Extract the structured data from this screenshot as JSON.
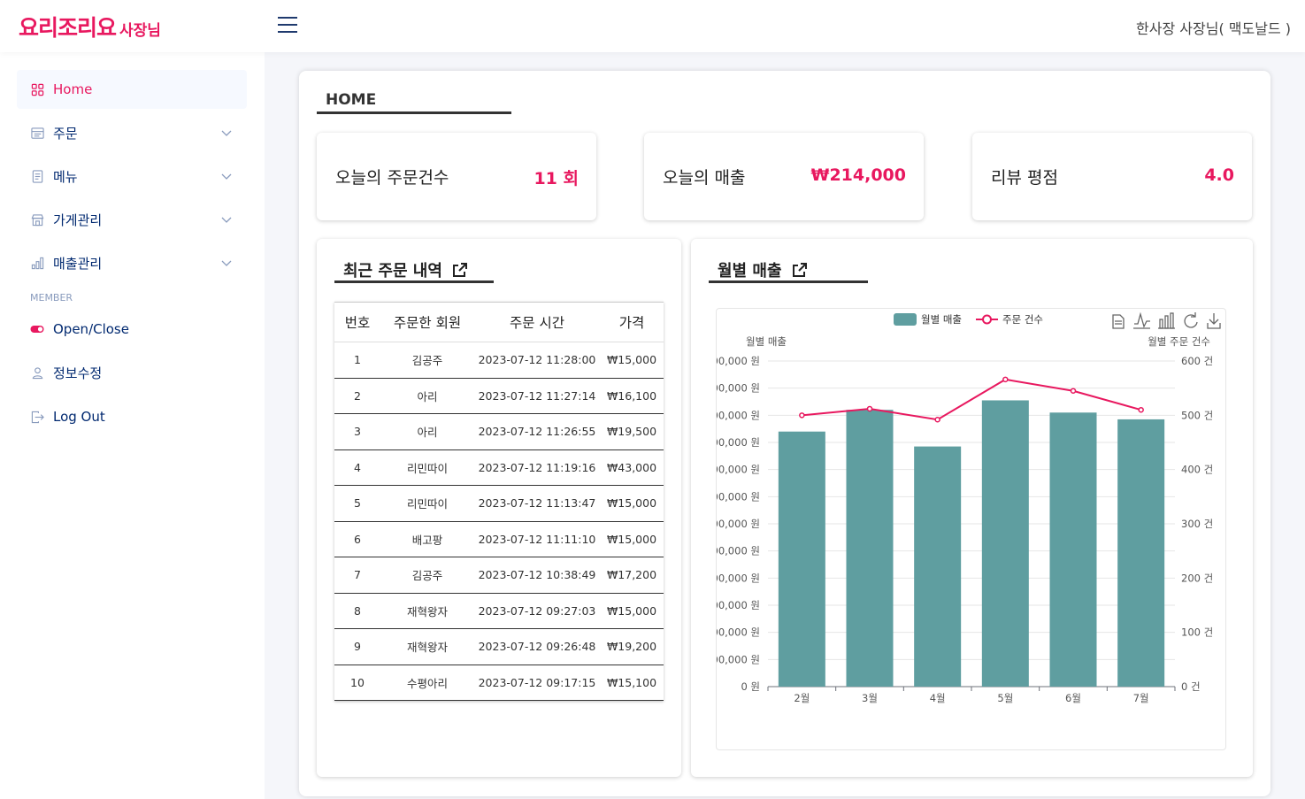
{
  "header": {
    "logo_main": "요리조리요",
    "logo_sub": "사장님",
    "user_label": "한사장 사장님( 맥도날드 )"
  },
  "sidebar": {
    "items": [
      {
        "label": "Home",
        "icon": "grid-icon",
        "active": true
      },
      {
        "label": "주문",
        "icon": "receipt-icon",
        "expandable": true
      },
      {
        "label": "메뉴",
        "icon": "document-icon",
        "expandable": true
      },
      {
        "label": "가게관리",
        "icon": "shop-icon",
        "expandable": true
      },
      {
        "label": "매출관리",
        "icon": "bar-chart-icon",
        "expandable": true
      }
    ],
    "member_heading": "MEMBER",
    "member_items": [
      {
        "label": "Open/Close",
        "icon": "toggle-icon"
      },
      {
        "label": "정보수정",
        "icon": "person-icon"
      },
      {
        "label": "Log Out",
        "icon": "logout-icon"
      }
    ]
  },
  "main": {
    "title": "HOME",
    "stats": [
      {
        "label": "오늘의 주문건수",
        "value": "11 회"
      },
      {
        "label": "오늘의 매출",
        "value": "₩214,000"
      },
      {
        "label": "리뷰 평점",
        "value": "4.0"
      }
    ],
    "recent_orders": {
      "title": "최근 주문 내역",
      "columns": [
        "번호",
        "주문한 회원",
        "주문 시간",
        "가격"
      ],
      "rows": [
        [
          "1",
          "김공주",
          "2023-07-12 11:28:00",
          "₩15,000"
        ],
        [
          "2",
          "아리",
          "2023-07-12 11:27:14",
          "₩16,100"
        ],
        [
          "3",
          "아리",
          "2023-07-12 11:26:55",
          "₩19,500"
        ],
        [
          "4",
          "리민따이",
          "2023-07-12 11:19:16",
          "₩43,000"
        ],
        [
          "5",
          "리민따이",
          "2023-07-12 11:13:47",
          "₩15,000"
        ],
        [
          "6",
          "배고팡",
          "2023-07-12 11:11:10",
          "₩15,000"
        ],
        [
          "7",
          "김공주",
          "2023-07-12 10:38:49",
          "₩17,200"
        ],
        [
          "8",
          "재혁왕자",
          "2023-07-12 09:27:03",
          "₩15,000"
        ],
        [
          "9",
          "재혁왕자",
          "2023-07-12 09:26:48",
          "₩19,200"
        ],
        [
          "10",
          "수평아리",
          "2023-07-12 09:17:15",
          "₩15,100"
        ]
      ]
    },
    "monthly_sales": {
      "title": "월별 매출"
    }
  },
  "colors": {
    "brand": "#e8185f",
    "nav_text": "#012970",
    "bar": "#5f9ea0",
    "line": "#e8185f"
  },
  "chart_data": {
    "type": "bar",
    "categories": [
      "2월",
      "3월",
      "4월",
      "5월",
      "6월",
      "7월"
    ],
    "series": [
      {
        "name": "월별 매출",
        "type": "bar",
        "axis": "left",
        "values": [
          9400000,
          10200000,
          8850000,
          10550000,
          10100000,
          9850000
        ]
      },
      {
        "name": "주문 건수",
        "type": "line",
        "axis": "right",
        "values": [
          500,
          512,
          492,
          566,
          545,
          510
        ]
      }
    ],
    "yleft": {
      "label": "월별 매출",
      "ticks": [
        "0 원",
        "00,000 원",
        "00,000 원",
        "00,000 원",
        "00,000 원",
        "00,000 원",
        "00,000 원",
        "00,000 원",
        "00,000 원",
        "00,000 원",
        "00,000 원",
        "00,000 원",
        "00,000 원"
      ],
      "ylim": [
        0,
        12000000
      ]
    },
    "yright": {
      "label": "월별 주문 건수",
      "ticks": [
        "0 건",
        "100 건",
        "200 건",
        "300 건",
        "400 건",
        "500 건",
        "600 건"
      ],
      "ylim": [
        0,
        600
      ]
    },
    "legend": "top-center",
    "grid": true
  }
}
